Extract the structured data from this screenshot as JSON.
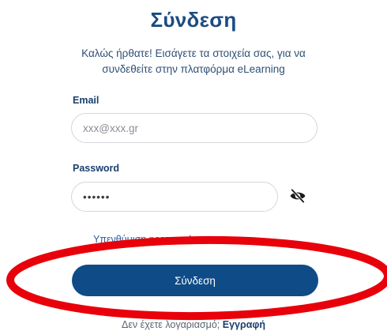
{
  "login": {
    "title": "Σύνδεση",
    "subtitle": "Καλώς ήρθατε! Εισάγετε τα στοιχεία σας, για να συνδεθείτε στην πλατφόρμα eLearning",
    "email_label": "Email",
    "email_placeholder": "xxx@xxx.gr",
    "password_label": "Password",
    "password_value": "••••••",
    "toggle_icon": "eye-slash-icon",
    "forgot_link": "Υπενθύμιση password",
    "submit_label": "Σύνδεση",
    "register_prompt": "Δεν έχετε λογαριασμό; ",
    "register_link": "Εγγραφή"
  },
  "annotation": {
    "highlight_color": "#e8000b"
  },
  "colors": {
    "title": "#1b4b82",
    "button": "#0f4b86",
    "link": "#2a5f9e"
  }
}
